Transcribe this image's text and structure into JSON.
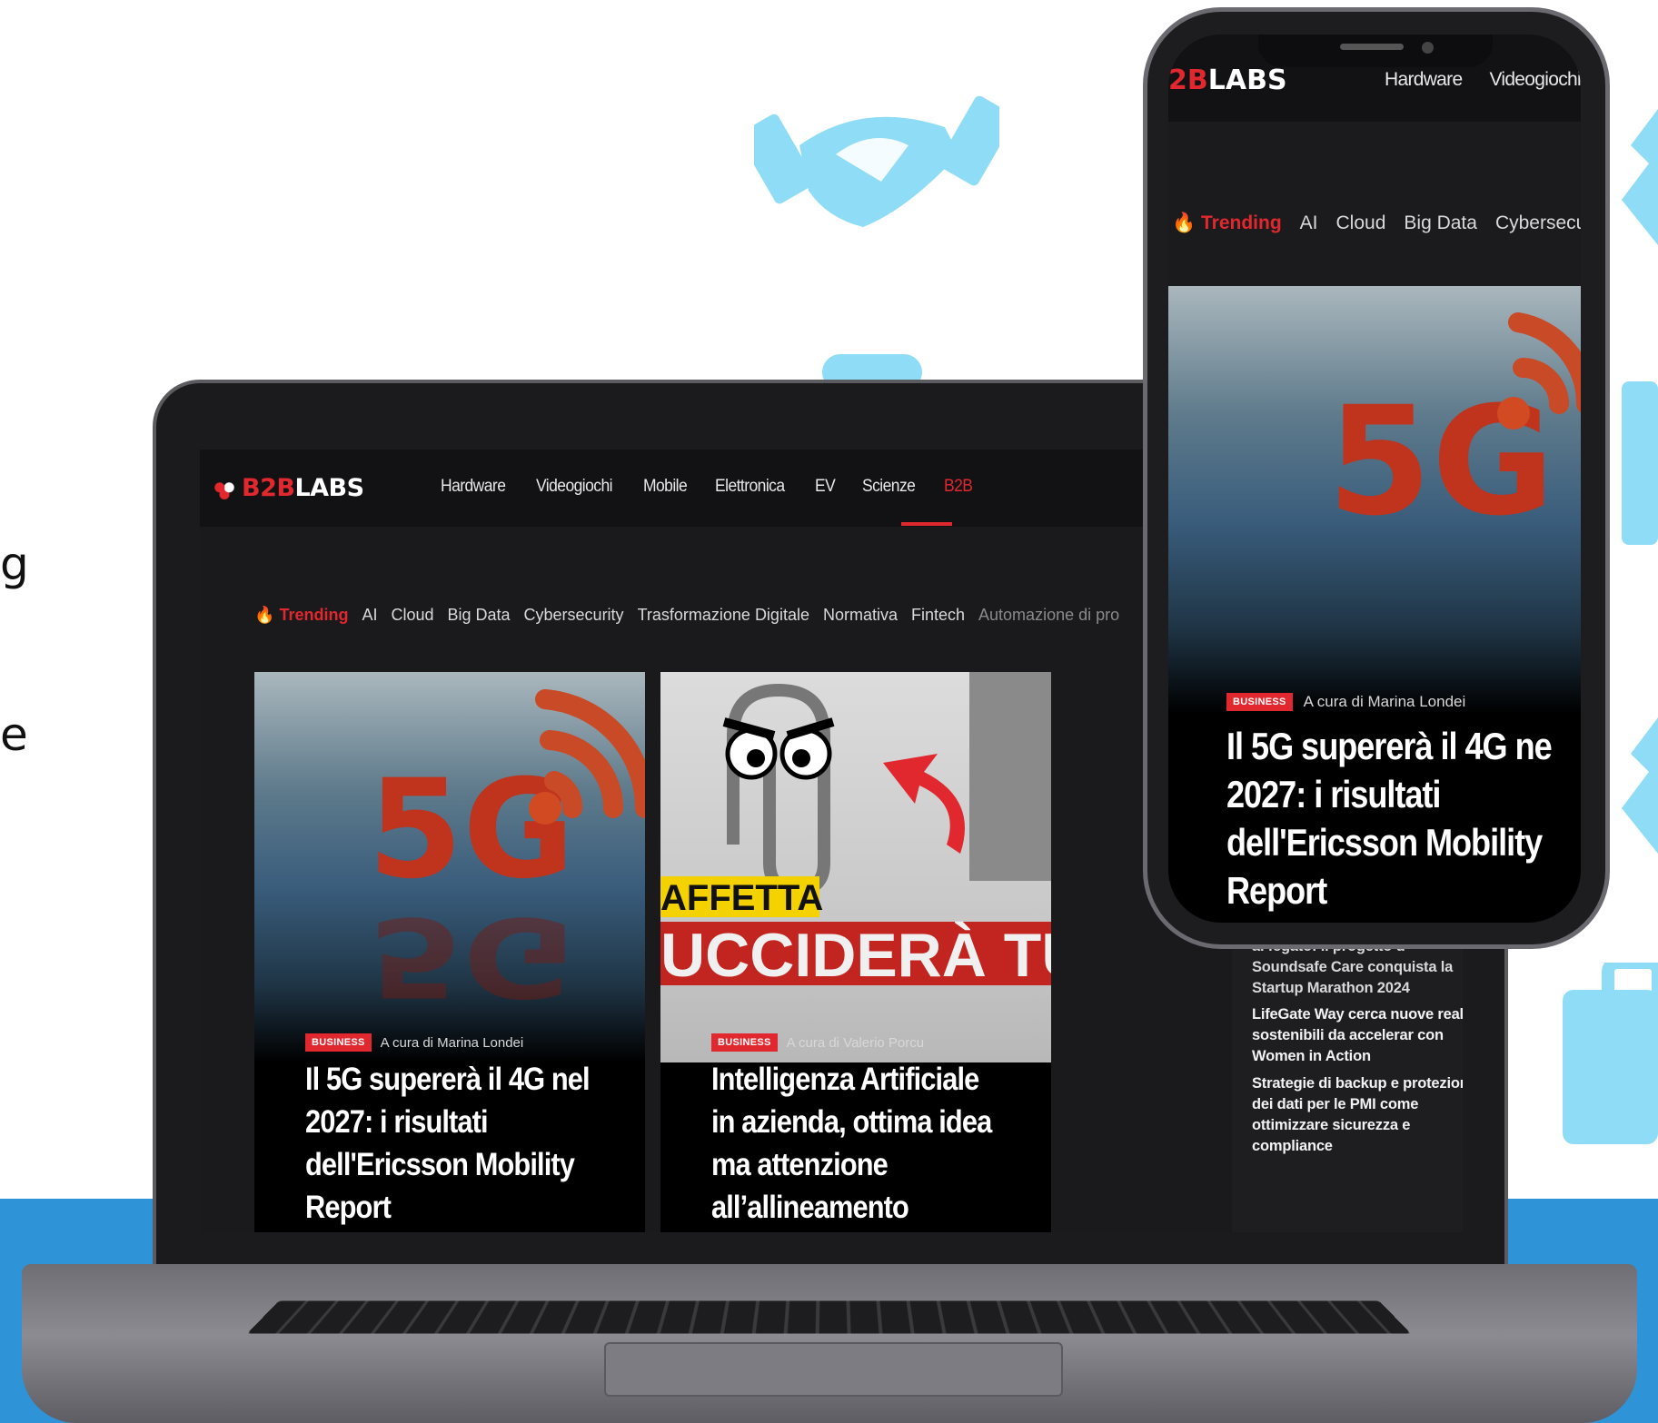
{
  "left_fragments": [
    "g",
    "e"
  ],
  "laptop": {
    "logo": {
      "red": "B2B",
      "white": "LABS"
    },
    "nav": [
      "Hardware",
      "Videogiochi",
      "Mobile",
      "Elettronica",
      "EV",
      "Scienze",
      "B2B"
    ],
    "trending": {
      "label": "Trending",
      "items": [
        "AI",
        "Cloud",
        "Big Data",
        "Cybersecurity",
        "Trasformazione Digitale",
        "Normativa",
        "Fintech",
        "Automazione di pro"
      ]
    },
    "cards": [
      {
        "overlay": "5G",
        "badge": "BUSINESS",
        "author": "A cura di Marina Londei",
        "title": "Il 5G supererà il 4G nel 2027: i risultati dell'Ericsson Mobility Report"
      },
      {
        "overlay_top": "AFFETTA",
        "overlay_bottom": "UCCIDERÀ TU",
        "badge": "BUSINESS",
        "author": "A cura di Valerio Porcu",
        "title": "Intelligenza Artificiale in azienda, ottima idea ma attenzione all’allineamento"
      }
    ],
    "sidebar": [
      "Ultrasuoni per trattare un cancro al fegato: il progetto d Soundsafe Care conquista la Startup Marathon 2024",
      "LifeGate Way cerca nuove realtà sostenibili da accelerar con Women in Action",
      "Strategie di backup e protezione dei dati per le PMI come ottimizzare sicurezza e compliance"
    ]
  },
  "phone": {
    "logo": {
      "red": "2B",
      "white": "LABS"
    },
    "nav": [
      "Hardware",
      "Videogiochi"
    ],
    "trending": {
      "label": "Trending",
      "items": [
        "AI",
        "Cloud",
        "Big Data",
        "Cybersecu"
      ]
    },
    "card": {
      "overlay": "5G",
      "badge": "BUSINESS",
      "author": "A cura di Marina Londei",
      "title_lines": [
        "Il 5G supererà il 4G ne",
        "2027: i risultati",
        "dell'Ericsson Mobility",
        "Report"
      ]
    }
  },
  "colors": {
    "accent": "#e0282e",
    "band": "#2f93d8",
    "deco": "#8fdcf7",
    "site_bg": "#1a1a1c"
  }
}
